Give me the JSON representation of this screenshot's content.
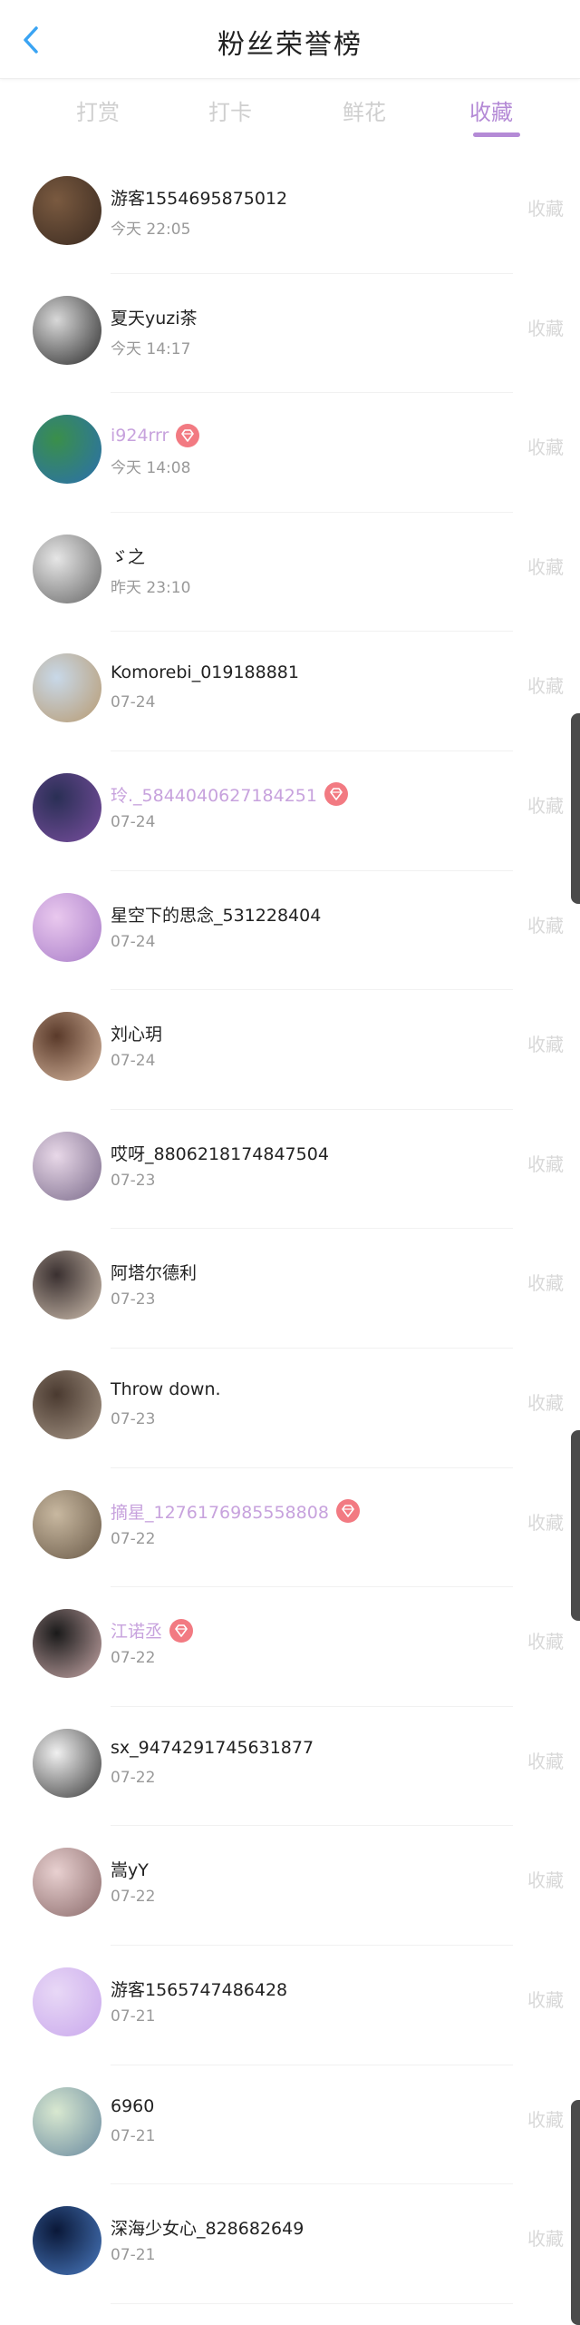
{
  "header": {
    "title": "粉丝荣誉榜",
    "back_icon": "chevron-left-icon",
    "accent": "#3aa4f3"
  },
  "tabs": [
    {
      "label": "打赏",
      "active": false
    },
    {
      "label": "打卡",
      "active": false
    },
    {
      "label": "鲜花",
      "active": false
    },
    {
      "label": "收藏",
      "active": true
    }
  ],
  "list": [
    {
      "name": "游客1554695875012",
      "time": "今天 22:05",
      "vip": false,
      "gem": false,
      "action": "收藏"
    },
    {
      "name": "夏天yuzi茶",
      "time": "今天 14:17",
      "vip": false,
      "gem": false,
      "action": "收藏"
    },
    {
      "name": "i924rrr",
      "time": "今天 14:08",
      "vip": true,
      "gem": true,
      "action": "收藏"
    },
    {
      "name": "ゞ之",
      "time": "昨天 23:10",
      "vip": false,
      "gem": false,
      "action": "收藏"
    },
    {
      "name": "Komorebi_019188881",
      "time": "07-24",
      "vip": false,
      "gem": false,
      "action": "收藏"
    },
    {
      "name": "玲._5844040627184251",
      "time": "07-24",
      "vip": true,
      "gem": true,
      "action": "收藏"
    },
    {
      "name": "星空下的思念_531228404",
      "time": "07-24",
      "vip": false,
      "gem": false,
      "action": "收藏"
    },
    {
      "name": "刘心玥",
      "time": "07-24",
      "vip": false,
      "gem": false,
      "action": "收藏"
    },
    {
      "name": "哎呀_8806218174847504",
      "time": "07-23",
      "vip": false,
      "gem": false,
      "action": "收藏"
    },
    {
      "name": "阿塔尔德利",
      "time": "07-23",
      "vip": false,
      "gem": false,
      "action": "收藏"
    },
    {
      "name": "Throw down.",
      "time": "07-23",
      "vip": false,
      "gem": false,
      "action": "收藏"
    },
    {
      "name": "摘星_1276176985558808",
      "time": "07-22",
      "vip": true,
      "gem": true,
      "action": "收藏"
    },
    {
      "name": "江诺丞",
      "time": "07-22",
      "vip": true,
      "gem": true,
      "action": "收藏"
    },
    {
      "name": "sx_9474291745631877",
      "time": "07-22",
      "vip": false,
      "gem": false,
      "action": "收藏"
    },
    {
      "name": "嵩yY",
      "time": "07-22",
      "vip": false,
      "gem": false,
      "action": "收藏"
    },
    {
      "name": "游客1565747486428",
      "time": "07-21",
      "vip": false,
      "gem": false,
      "action": "收藏"
    },
    {
      "name": "6960",
      "time": "07-21",
      "vip": false,
      "gem": false,
      "action": "收藏"
    },
    {
      "name": "深海少女心_828682649",
      "time": "07-21",
      "vip": false,
      "gem": false,
      "action": "收藏"
    }
  ]
}
